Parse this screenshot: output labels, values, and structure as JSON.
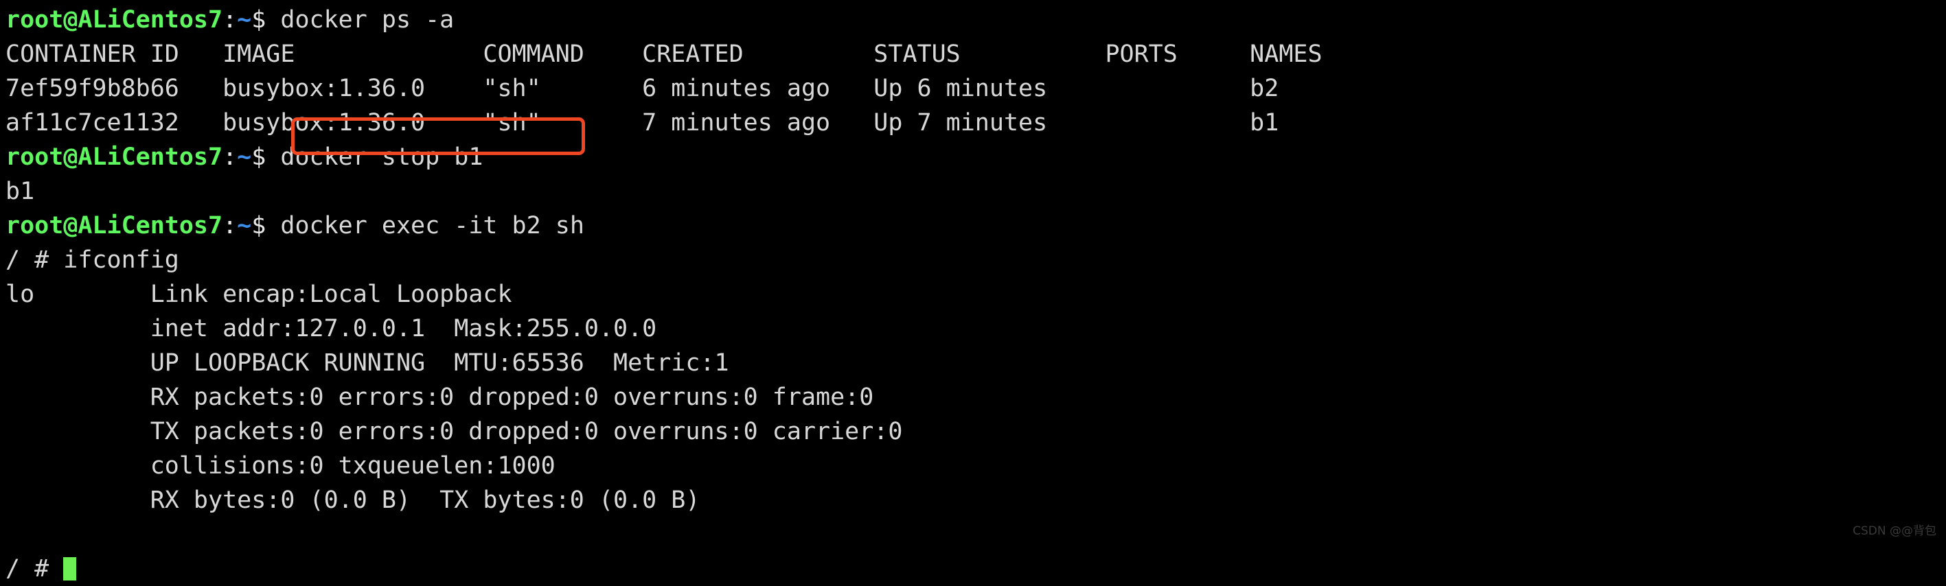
{
  "terminal": {
    "background_color": "#000000",
    "foreground_color": "#d8d8d8",
    "prompt_user_color": "#5ff75f",
    "prompt_path_color": "#3b8eea",
    "cursor_color": "#6cf054",
    "highlight_color": "#f04723"
  },
  "prompt": {
    "user_host": "root@ALiCentos7",
    "colon": ":",
    "path": "~",
    "symbol": "$",
    "container_prompt": "/ #"
  },
  "commands": {
    "docker_ps": " docker ps -a",
    "docker_stop": " docker stop b1",
    "docker_exec": " docker exec -it b2 sh",
    "ifconfig": " ifconfig"
  },
  "ps_table": {
    "header": "CONTAINER ID   IMAGE             COMMAND    CREATED         STATUS          PORTS     NAMES",
    "rows": [
      "7ef59f9b8b66   busybox:1.36.0    \"sh\"       6 minutes ago   Up 6 minutes              b2",
      "af11c7ce1132   busybox:1.36.0    \"sh\"       7 minutes ago   Up 7 minutes              b1"
    ]
  },
  "stop_output": "b1",
  "ifconfig_output": [
    "lo        Link encap:Local Loopback",
    "          inet addr:127.0.0.1  Mask:255.0.0.0",
    "          UP LOOPBACK RUNNING  MTU:65536  Metric:1",
    "          RX packets:0 errors:0 dropped:0 overruns:0 frame:0",
    "          TX packets:0 errors:0 dropped:0 overruns:0 carrier:0",
    "          collisions:0 txqueuelen:1000",
    "          RX bytes:0 (0.0 B)  TX bytes:0 (0.0 B)"
  ],
  "blank_line": "",
  "watermark": "CSDN @@背包"
}
